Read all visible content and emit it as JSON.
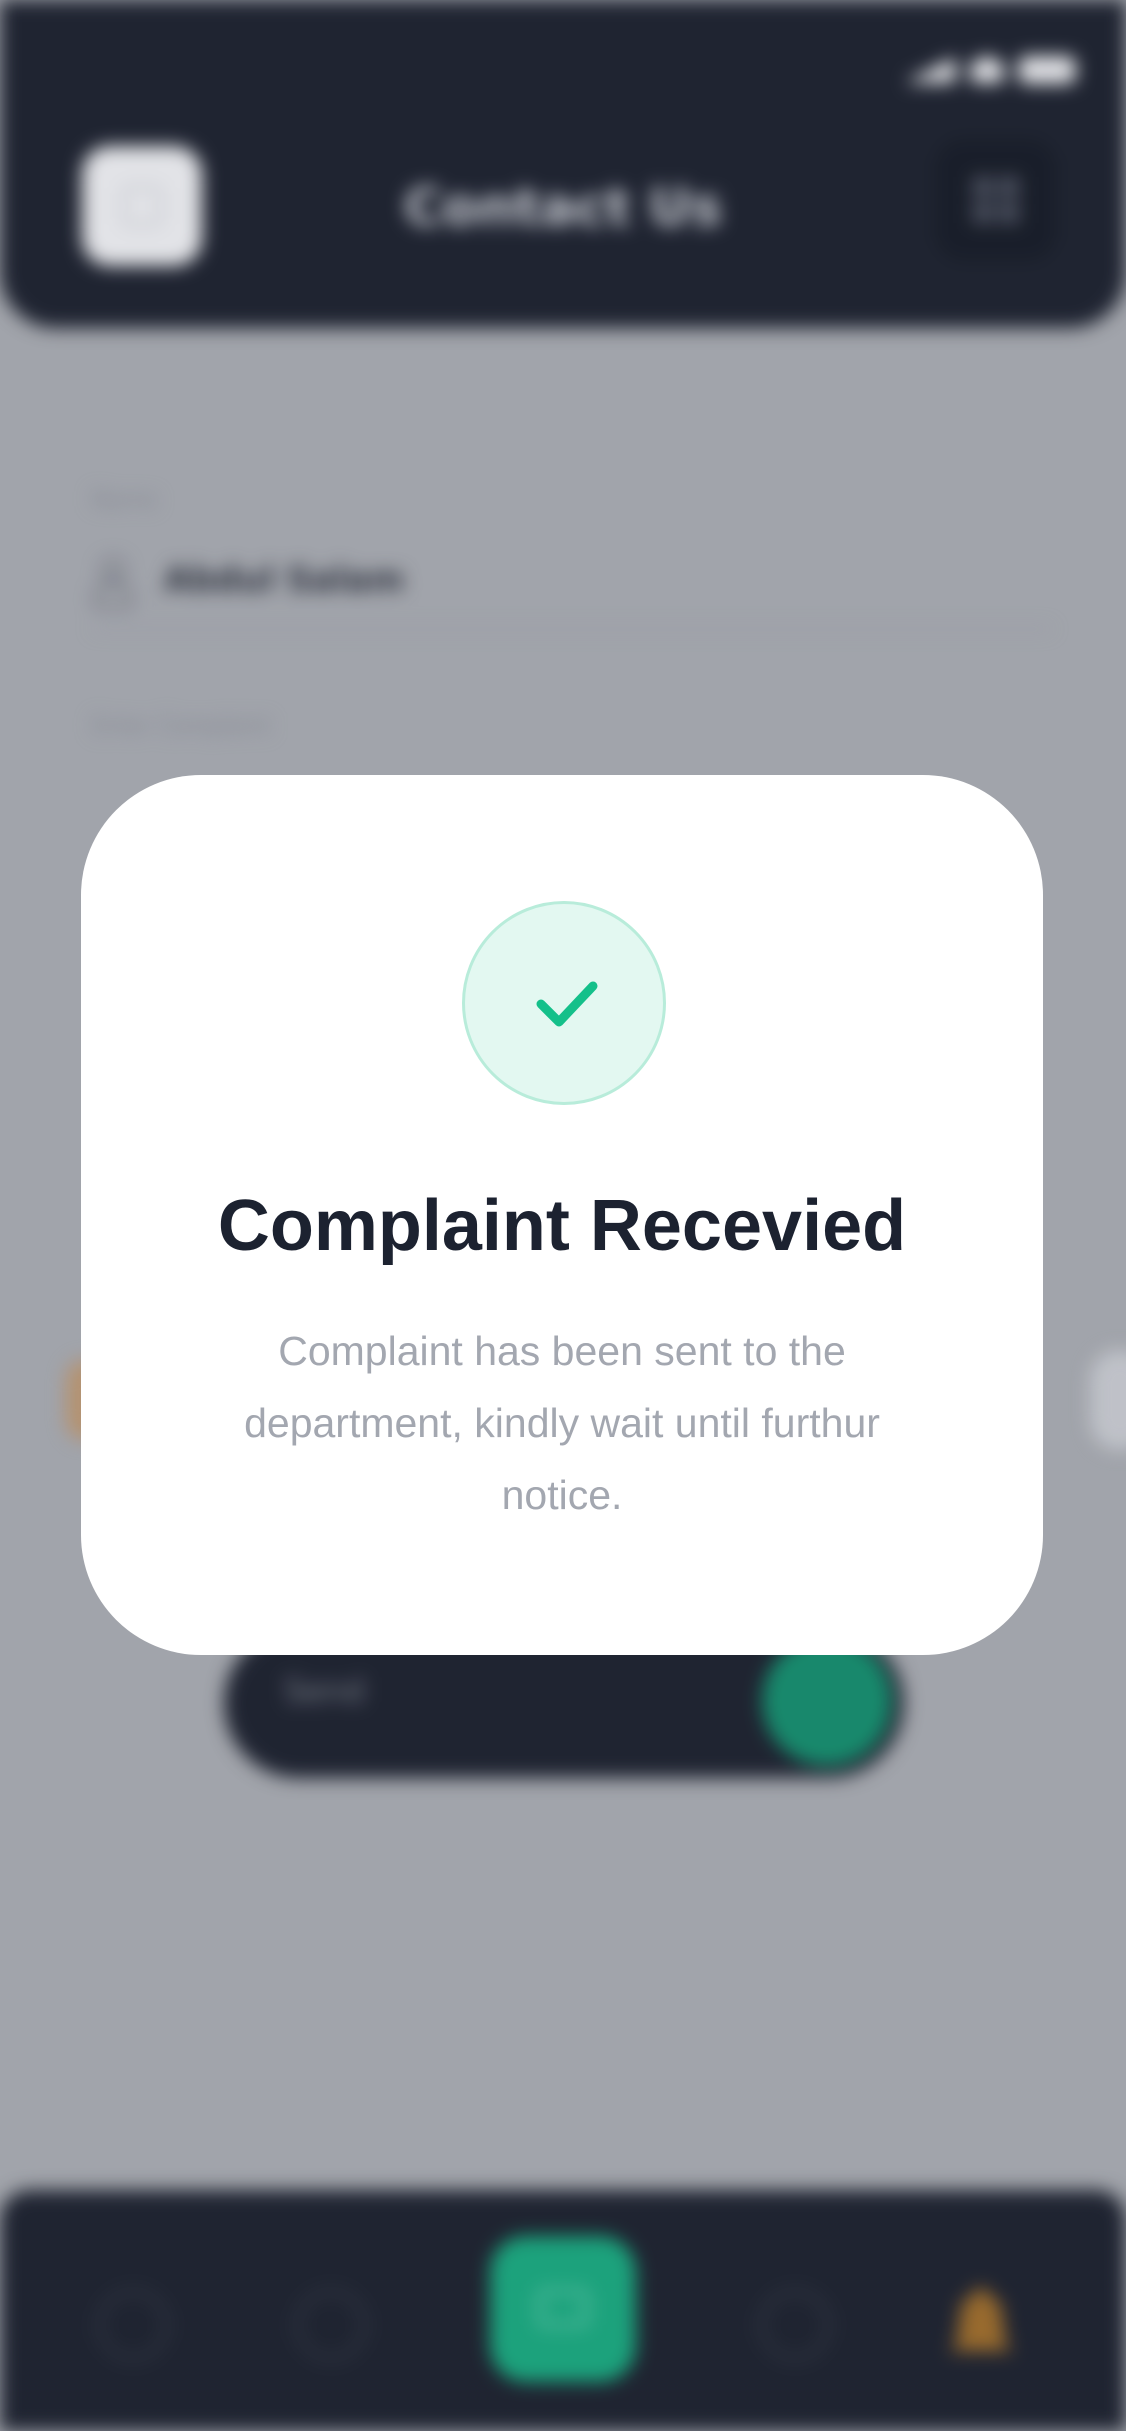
{
  "colors": {
    "header_bg": "#1b202d",
    "accent": "#18a57c",
    "success_bg": "#e3f8f1",
    "check": "#14c08a",
    "title_text": "#1c2230",
    "muted_text": "#a3a7b0"
  },
  "header": {
    "title": "Contact Us",
    "back_icon": "chevron-left-icon",
    "menu_icon": "grid-menu-icon"
  },
  "form": {
    "name_label": "Name",
    "name_value": "Abdul Salam",
    "complaint_label": "Enter Complaint"
  },
  "send_bar": {
    "label": "Send"
  },
  "modal": {
    "icon": "check-icon",
    "title": "Complaint Recevied",
    "message": "Complaint has been sent to the department, kindly wait until furthur notice."
  },
  "bottom_nav": {
    "items": [
      "home-icon",
      "user-icon",
      "mail-icon",
      "chat-icon",
      "bell-icon"
    ],
    "active": "mail-icon"
  }
}
